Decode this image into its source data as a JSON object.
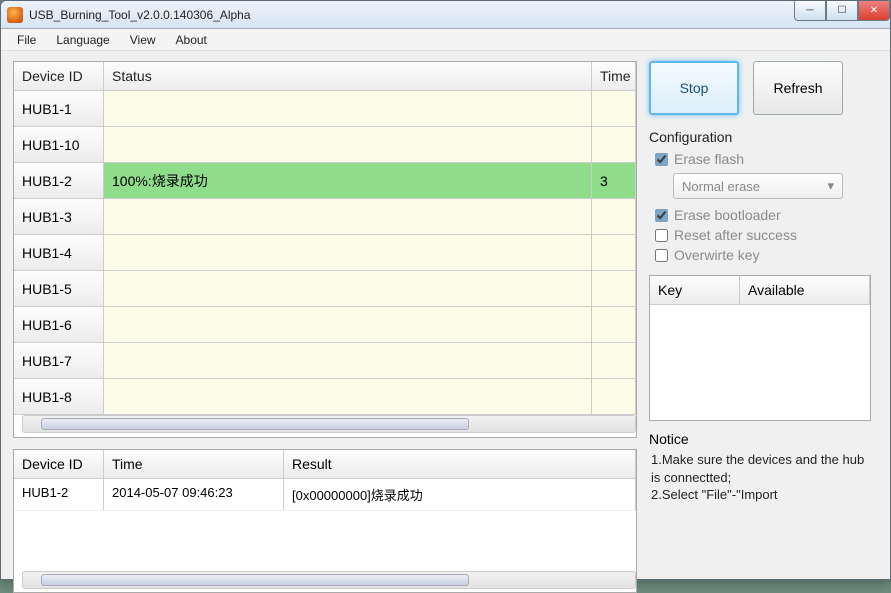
{
  "window": {
    "title": "USB_Burning_Tool_v2.0.0.140306_Alpha"
  },
  "menu": {
    "file": "File",
    "language": "Language",
    "view": "View",
    "about": "About"
  },
  "main_table": {
    "headers": {
      "id": "Device ID",
      "status": "Status",
      "time": "Time"
    },
    "rows": [
      {
        "id": "HUB1-1",
        "status": "",
        "time": "",
        "success": false
      },
      {
        "id": "HUB1-10",
        "status": "",
        "time": "",
        "success": false
      },
      {
        "id": "HUB1-2",
        "status": "100%:烧录成功",
        "time": "3",
        "success": true
      },
      {
        "id": "HUB1-3",
        "status": "",
        "time": "",
        "success": false
      },
      {
        "id": "HUB1-4",
        "status": "",
        "time": "",
        "success": false
      },
      {
        "id": "HUB1-5",
        "status": "",
        "time": "",
        "success": false
      },
      {
        "id": "HUB1-6",
        "status": "",
        "time": "",
        "success": false
      },
      {
        "id": "HUB1-7",
        "status": "",
        "time": "",
        "success": false
      },
      {
        "id": "HUB1-8",
        "status": "",
        "time": "",
        "success": false
      }
    ]
  },
  "log_table": {
    "headers": {
      "id": "Device ID",
      "time": "Time",
      "result": "Result"
    },
    "rows": [
      {
        "id": "HUB1-2",
        "time": "2014-05-07 09:46:23",
        "result": "[0x00000000]烧录成功"
      }
    ]
  },
  "buttons": {
    "stop": "Stop",
    "refresh": "Refresh"
  },
  "config": {
    "title": "Configuration",
    "erase_flash": {
      "label": "Erase flash",
      "checked": true
    },
    "erase_mode": {
      "value": "Normal erase"
    },
    "erase_bootloader": {
      "label": "Erase bootloader",
      "checked": true
    },
    "reset_after": {
      "label": "Reset after success",
      "checked": false
    },
    "overwrite_key": {
      "label": "Overwirte key",
      "checked": false
    }
  },
  "key_table": {
    "headers": {
      "key": "Key",
      "available": "Available"
    }
  },
  "notice": {
    "title": "Notice",
    "body": "1.Make sure the devices and the hub is connectted;\n2.Select \"File\"-\"Import"
  }
}
